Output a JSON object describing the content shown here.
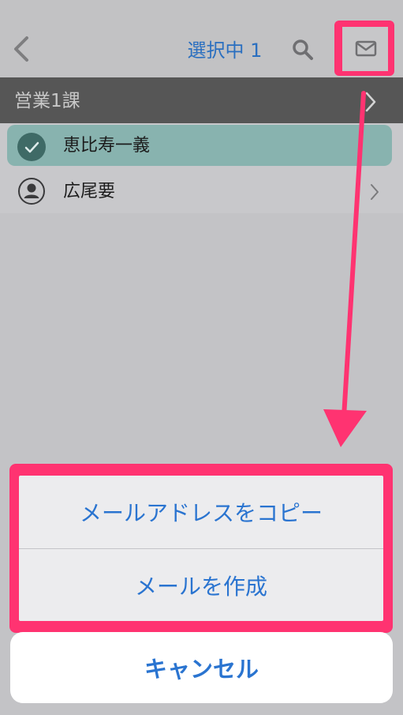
{
  "navbar": {
    "back_icon": "chevron-left-icon",
    "title": "選択中 1",
    "search_icon": "search-icon",
    "mail_icon": "envelope-icon"
  },
  "section": {
    "title": "営業1課",
    "chevron_icon": "chevron-right-icon"
  },
  "contacts": [
    {
      "name": "恵比寿一義",
      "selected": true,
      "icon": "checkmark-circle-icon"
    },
    {
      "name": "広尾要",
      "selected": false,
      "icon": "person-circle-icon"
    }
  ],
  "action_sheet": {
    "copy_email_label": "メールアドレスをコピー",
    "compose_email_label": "メールを作成",
    "cancel_label": "キャンセル"
  },
  "colors": {
    "accent": "#2a74d0",
    "highlight": "#ff3371",
    "selected_row": "#88b3af",
    "section_header": "#565656"
  }
}
